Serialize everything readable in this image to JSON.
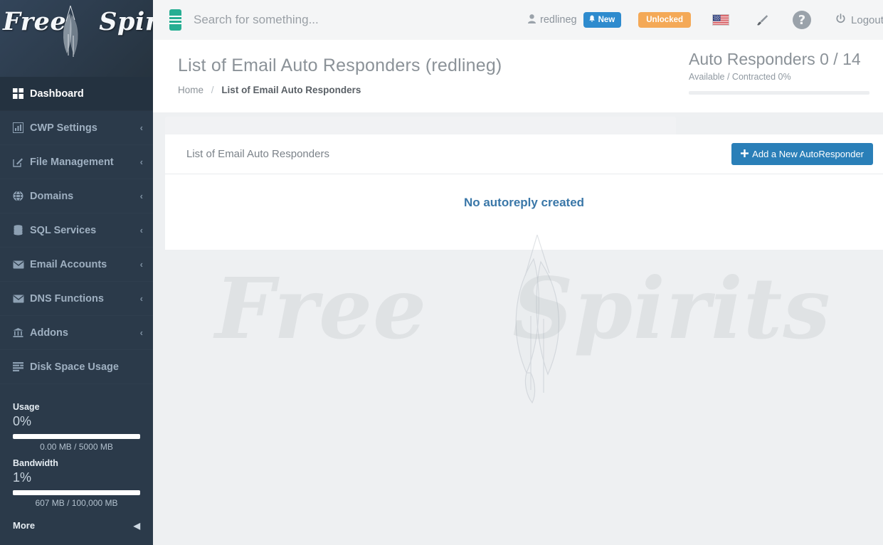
{
  "brand": {
    "logo_word1": "Free",
    "logo_word2": "Spirits",
    "feather_icon": "feather-icon"
  },
  "sidebar": {
    "items": [
      {
        "label": "Dashboard",
        "icon": "dashboard-grid-icon",
        "chevron": "",
        "active": true
      },
      {
        "label": "CWP Settings",
        "icon": "bar-chart-icon",
        "chevron": "‹",
        "active": false
      },
      {
        "label": "File Management",
        "icon": "edit-square-icon",
        "chevron": "‹",
        "active": false
      },
      {
        "label": "Domains",
        "icon": "globe-icon",
        "chevron": "‹",
        "active": false
      },
      {
        "label": "SQL Services",
        "icon": "database-icon",
        "chevron": "‹",
        "active": false
      },
      {
        "label": "Email Accounts",
        "icon": "envelope-icon",
        "chevron": "‹",
        "active": false
      },
      {
        "label": "DNS Functions",
        "icon": "envelope-icon",
        "chevron": "‹",
        "active": false
      },
      {
        "label": "Addons",
        "icon": "bank-columns-icon",
        "chevron": "‹",
        "active": false
      },
      {
        "label": "Disk Space Usage",
        "icon": "list-rows-icon",
        "chevron": "",
        "active": false
      }
    ],
    "usage": {
      "title": "Usage",
      "percent_label": "0%",
      "percent_value": 0,
      "detail": "0.00 MB / 5000 MB"
    },
    "bandwidth": {
      "title": "Bandwidth",
      "percent_label": "1%",
      "percent_value": 1,
      "detail": "607 MB / 100,000 MB"
    },
    "more_label": "More",
    "more_chevron": "◀"
  },
  "topbar": {
    "menu_toggle_icon": "hamburger-icon",
    "search": {
      "placeholder": "Search for something...",
      "value": ""
    },
    "user": {
      "name": "redlineg",
      "icon": "user-icon"
    },
    "new_badge": {
      "label": "New",
      "icon": "bell-icon",
      "color": "#2e8bce"
    },
    "unlocked_badge": {
      "label": "Unlocked",
      "color": "#f4a957"
    },
    "language_flag": "us-flag-icon",
    "theme_icon": "paintbrush-icon",
    "help_icon": "question-circle-icon",
    "logout": {
      "label": "Logout",
      "icon": "power-icon"
    }
  },
  "page": {
    "title": "List of Email Auto Responders (redlineg)",
    "breadcrumb": {
      "home": "Home",
      "separator": "/",
      "current": "List of Email Auto Responders"
    }
  },
  "stat_panel": {
    "title": "Auto Responders 0 / 14",
    "subtitle": "Available / Contracted 0%",
    "progress_percent": 0
  },
  "card": {
    "header_title": "List of Email Auto Responders",
    "add_button": {
      "label": "Add a New AutoResponder",
      "icon": "plus-icon",
      "color": "#2a7fb8"
    },
    "empty_message": "No autoreply created",
    "empty_message_color": "#3a77a8"
  },
  "annotation": {
    "arrow": {
      "name": "red-up-arrow",
      "color": "#d42426",
      "direction": "up",
      "points_at": "Add a New AutoResponder"
    }
  },
  "watermark": {
    "word1": "Free",
    "word2": "Spirits"
  }
}
